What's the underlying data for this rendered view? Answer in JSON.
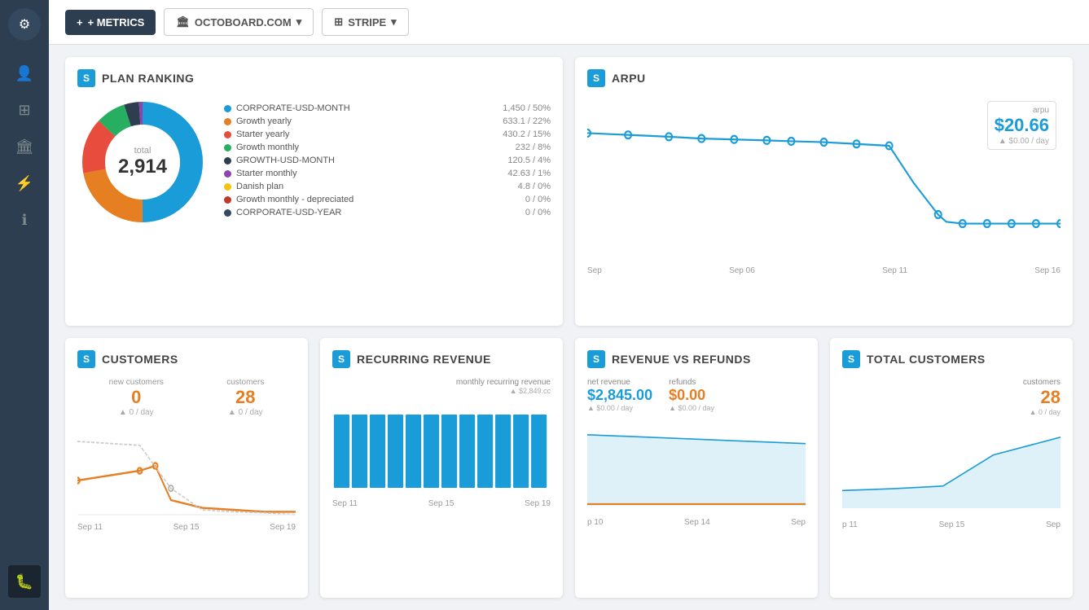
{
  "sidebar": {
    "logo_char": "⚙",
    "items": [
      {
        "icon": "👤",
        "name": "profile",
        "active": false
      },
      {
        "icon": "⊞",
        "name": "dashboard",
        "active": false
      },
      {
        "icon": "🏛",
        "name": "bank",
        "active": false
      },
      {
        "icon": "⚡",
        "name": "integrations",
        "active": false
      },
      {
        "icon": "ℹ",
        "name": "info",
        "active": false
      },
      {
        "icon": "🐛",
        "name": "debug",
        "active": true
      }
    ]
  },
  "topbar": {
    "add_label": "+ METRICS",
    "octoboard_label": "OCTOBOARD.COM",
    "stripe_label": "STRIPE"
  },
  "plan_ranking": {
    "title": "PLAN RANKING",
    "total_label": "total",
    "total_value": "2,914",
    "plans": [
      {
        "name": "CORPORATE-USD-MONTH",
        "value": "1,450 / 50%",
        "color": "#1a9cd8"
      },
      {
        "name": "Growth yearly",
        "value": "633.1 / 22%",
        "color": "#e67e22"
      },
      {
        "name": "Starter yearly",
        "value": "430.2 / 15%",
        "color": "#e74c3c"
      },
      {
        "name": "Growth monthly",
        "value": "232 /  8%",
        "color": "#27ae60"
      },
      {
        "name": "GROWTH-USD-MONTH",
        "value": "120.5 /  4%",
        "color": "#2c3e50"
      },
      {
        "name": "Starter monthly",
        "value": "42.63 /  1%",
        "color": "#8e44ad"
      },
      {
        "name": "Danish plan",
        "value": "4.8 /  0%",
        "color": "#f1c40f"
      },
      {
        "name": "Growth monthly - depreciated",
        "value": "0 /  0%",
        "color": "#c0392b"
      },
      {
        "name": "CORPORATE-USD-YEAR",
        "value": "0 /  0%",
        "color": "#34495e"
      }
    ]
  },
  "arpu": {
    "title": "ARPU",
    "badge_label": "arpu",
    "value": "$20.66",
    "sub": "▲ $0.00 / day",
    "axis": [
      "Sep",
      "Sep 06",
      "Sep 11",
      "Sep 16"
    ]
  },
  "customers": {
    "title": "CUSTOMERS",
    "new_label": "new customers",
    "new_value": "0",
    "new_sub": "▲ 0 / day",
    "cust_label": "customers",
    "cust_value": "28",
    "cust_sub": "▲ 0 / day",
    "axis": [
      "Sep 11",
      "Sep 15",
      "Sep 19"
    ]
  },
  "recurring": {
    "title": "RECURRING REVENUE",
    "label": "monthly recurring revenue",
    "sub": "▲ $2,849.cc",
    "axis": [
      "Sep 11",
      "Sep 15",
      "Sep 19"
    ]
  },
  "revenue_refunds": {
    "title": "REVENUE VS REFUNDS",
    "net_label": "net revenue",
    "refunds_label": "refunds",
    "net_value": "$2,845.00",
    "net_sub": "▲ $0.00 / day",
    "refunds_value": "$0.00",
    "refunds_sub": "▲ $0.00 / day",
    "axis": [
      "p 10",
      "Sep 14",
      "Sep"
    ]
  },
  "total_customers": {
    "title": "TOTAL CUSTOMERS",
    "label": "customers",
    "value": "28",
    "sub": "▲ 0 / day",
    "axis": [
      "p 11",
      "Sep 15",
      "Sep"
    ]
  }
}
